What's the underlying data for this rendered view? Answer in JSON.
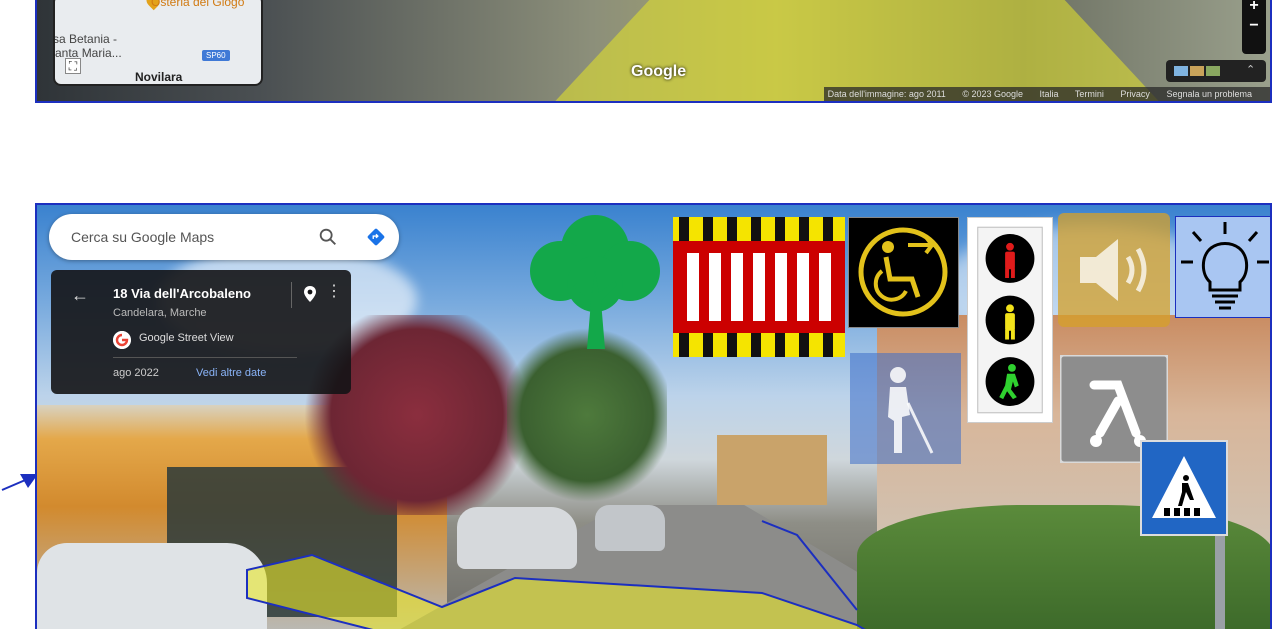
{
  "top_view": {
    "minimap": {
      "place_osteria": "Osteria del Giogo",
      "place_betania": "sa Betania -",
      "place_maria": "anta Maria...",
      "place_novilara": "Novilara",
      "road_label": "SP60"
    },
    "google_logo": "Google",
    "zoom_in": "+",
    "zoom_out": "−",
    "attribution": {
      "date": "Data dell'immagine: ago 2011",
      "copyright": "© 2023 Google",
      "country": "Italia",
      "terms": "Termini",
      "privacy": "Privacy",
      "report": "Segnala un problema"
    }
  },
  "search": {
    "placeholder": "Cerca su Google Maps"
  },
  "info_card": {
    "address": "18 Via dell'Arcobaleno",
    "locality": "Candelara, Marche",
    "source": "Google Street View",
    "date": "ago 2022",
    "more_dates": "Vedi altre date"
  },
  "colors": {
    "frame_border": "#1c2fbf",
    "tree_green": "#13a84a",
    "crosswalk_red": "#cc0000",
    "crosswalk_yellow": "#f5e400",
    "wheelchair_gold": "#e3c21b",
    "path_highlight": "#e8e62a"
  },
  "icons": [
    "tree-icon",
    "crosswalk-icon",
    "wheelchair-icon",
    "traffic-light-icon",
    "sound-icon",
    "bulb-icon",
    "blind-person-icon",
    "stroller-icon",
    "pedestrian-crossing-sign"
  ]
}
